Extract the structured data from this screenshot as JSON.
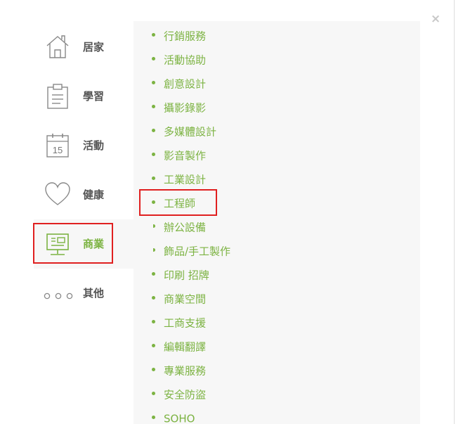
{
  "close_glyph": "×",
  "categories": [
    {
      "label": "居家",
      "icon": "house-icon"
    },
    {
      "label": "學習",
      "icon": "clipboard-icon"
    },
    {
      "label": "活動",
      "icon": "calendar-icon",
      "icon_text": "15"
    },
    {
      "label": "健康",
      "icon": "heart-icon"
    },
    {
      "label": "商業",
      "icon": "presentation-board-icon",
      "active": true
    },
    {
      "label": "其他",
      "icon": "more-dots-icon"
    }
  ],
  "subcategories": [
    "行銷服務",
    "活動協助",
    "創意設計",
    "攝影錄影",
    "多媒體設計",
    "影音製作",
    "工業設計",
    "工程師",
    "辦公設備",
    "飾品/手工製作",
    "印刷 招牌",
    "商業空間",
    "工商支援",
    "編輯翻譯",
    "專業服務",
    "安全防盜",
    "SOHO"
  ],
  "colors": {
    "accent": "#7cb342",
    "text": "#555555",
    "highlight_box": "#e02020",
    "panel_bg": "#f7f7f7"
  }
}
